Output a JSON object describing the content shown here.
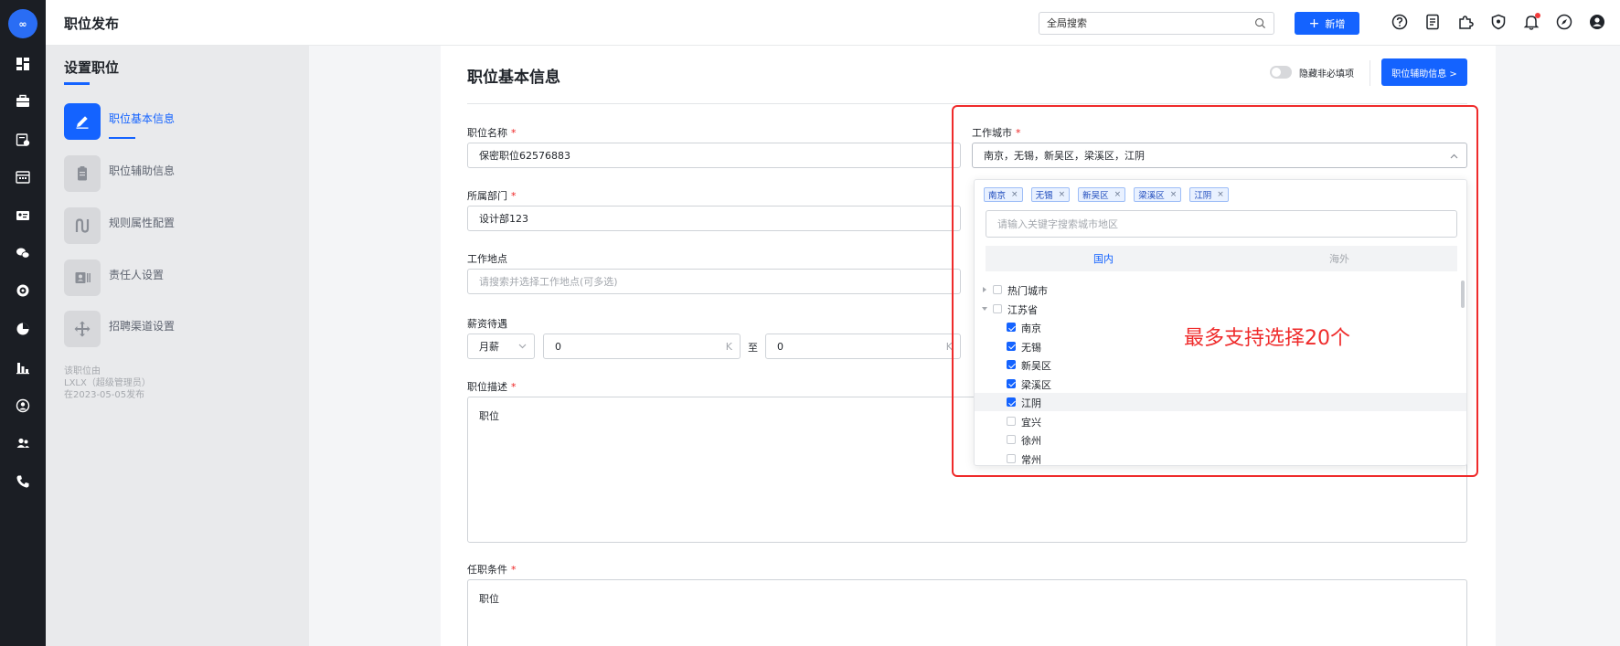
{
  "app": {
    "logo_text": "∞"
  },
  "rail": {
    "icons": [
      "dashboard-icon",
      "briefcase-icon",
      "calendar-clock-icon",
      "schedule-icon",
      "id-card-icon",
      "chat-icon",
      "target-icon",
      "pie-chart-icon",
      "bar-chart-icon",
      "user-circle-icon",
      "users-icon",
      "phone-icon"
    ]
  },
  "header": {
    "title": "职位发布",
    "search_placeholder": "全局搜索",
    "new_label": "新增",
    "icons": [
      "help-icon",
      "document-icon",
      "puzzle-icon",
      "shield-icon",
      "bell-icon",
      "compass-icon",
      "account-icon"
    ]
  },
  "sidebar": {
    "title": "设置职位",
    "steps": [
      {
        "label": "职位基本信息",
        "icon": "pencil-icon",
        "active": true
      },
      {
        "label": "职位辅助信息",
        "icon": "clipboard-icon",
        "active": false
      },
      {
        "label": "规则属性配置",
        "icon": "route-icon",
        "active": false
      },
      {
        "label": "责任人设置",
        "icon": "contact-card-icon",
        "active": false
      },
      {
        "label": "招聘渠道设置",
        "icon": "move-arrows-icon",
        "active": false
      }
    ],
    "meta": {
      "line1": "该职位由",
      "line2": "LXLX（超级管理员）",
      "line3": "在2023-05-05发布"
    }
  },
  "form": {
    "section_title": "职位基本信息",
    "hide_optional_label": "隐藏非必填项",
    "aux_button_label": "职位辅助信息 >",
    "required_mark": "*",
    "job_name": {
      "label": "职位名称",
      "value": "保密职位62576883"
    },
    "department": {
      "label": "所属部门",
      "value": "设计部123"
    },
    "location": {
      "label": "工作地点",
      "placeholder": "请搜索并选择工作地点(可多选)"
    },
    "salary": {
      "label": "薪资待遇",
      "type": "月薪",
      "min": "0",
      "max": "0",
      "unit": "K",
      "to": "至"
    },
    "description": {
      "label": "职位描述",
      "value": "职位"
    },
    "requirements": {
      "label": "任职条件",
      "value": "职位"
    },
    "work_city": {
      "label": "工作城市",
      "value": "南京，无锡，新吴区，梁溪区，江阴"
    }
  },
  "city_dropdown": {
    "tags": [
      "南京",
      "无锡",
      "新吴区",
      "梁溪区",
      "江阴"
    ],
    "tag_close": "×",
    "search_placeholder": "请输入关键字搜索城市地区",
    "tabs": [
      {
        "label": "国内",
        "active": true
      },
      {
        "label": "海外",
        "active": false
      }
    ],
    "tree": [
      {
        "label": "热门城市",
        "level": 0,
        "checked": false,
        "expanded": false
      },
      {
        "label": "江苏省",
        "level": 0,
        "checked": false,
        "expanded": true
      },
      {
        "label": "南京",
        "level": 1,
        "checked": true
      },
      {
        "label": "无锡",
        "level": 1,
        "checked": true
      },
      {
        "label": "新吴区",
        "level": 1,
        "checked": true
      },
      {
        "label": "梁溪区",
        "level": 1,
        "checked": true
      },
      {
        "label": "江阴",
        "level": 1,
        "checked": true,
        "highlighted": true
      },
      {
        "label": "宜兴",
        "level": 1,
        "checked": false
      },
      {
        "label": "徐州",
        "level": 1,
        "checked": false
      },
      {
        "label": "常州",
        "level": 1,
        "checked": false
      }
    ]
  },
  "annotation": {
    "text": "最多支持选择20个",
    "color": "#ef2b2b"
  },
  "colors": {
    "primary": "#1463ff",
    "rail": "#1b1e24",
    "required": "#ee2222"
  }
}
